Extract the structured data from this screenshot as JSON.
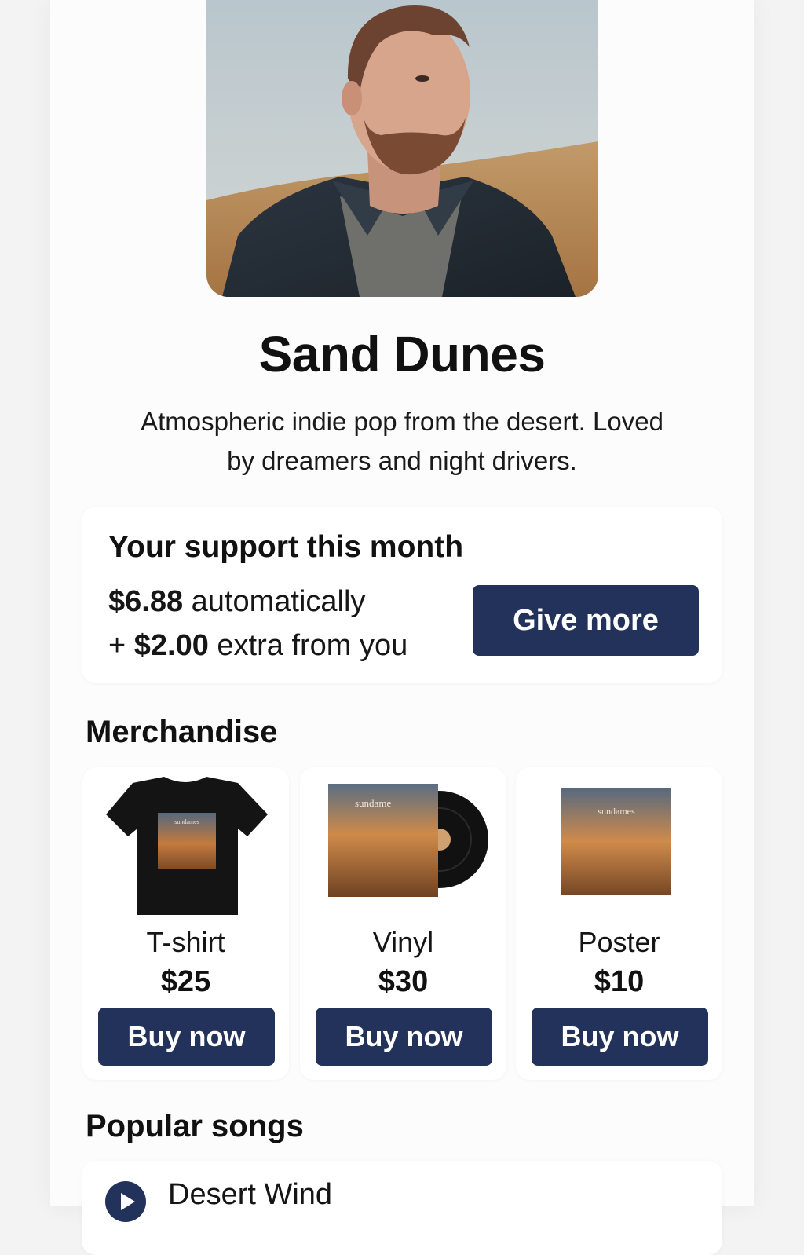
{
  "artist": {
    "name": "Sand Dunes",
    "bio": "Atmospheric indie pop from the desert. Loved by dreamers and night drivers."
  },
  "support": {
    "title": "Your support this month",
    "auto_amount": "$6.88",
    "auto_text": "automatically",
    "extra_prefix": "+",
    "extra_amount": "$2.00",
    "extra_text": "extra from you",
    "button_label": "Give more"
  },
  "merchandise": {
    "title": "Merchandise",
    "items": [
      {
        "name": "T-shirt",
        "price": "$25",
        "button": "Buy now",
        "artwork_text": "sundames"
      },
      {
        "name": "Vinyl",
        "price": "$30",
        "button": "Buy now",
        "artwork_text": "sundame"
      },
      {
        "name": "Poster",
        "price": "$10",
        "button": "Buy now",
        "artwork_text": "sundames"
      }
    ]
  },
  "songs": {
    "title": "Popular songs",
    "items": [
      {
        "name": "Desert Wind"
      }
    ]
  },
  "colors": {
    "accent": "#22325a",
    "sand": "#b0834f",
    "sky": "#bcc8cf"
  },
  "icons": {
    "play": "play-icon"
  }
}
